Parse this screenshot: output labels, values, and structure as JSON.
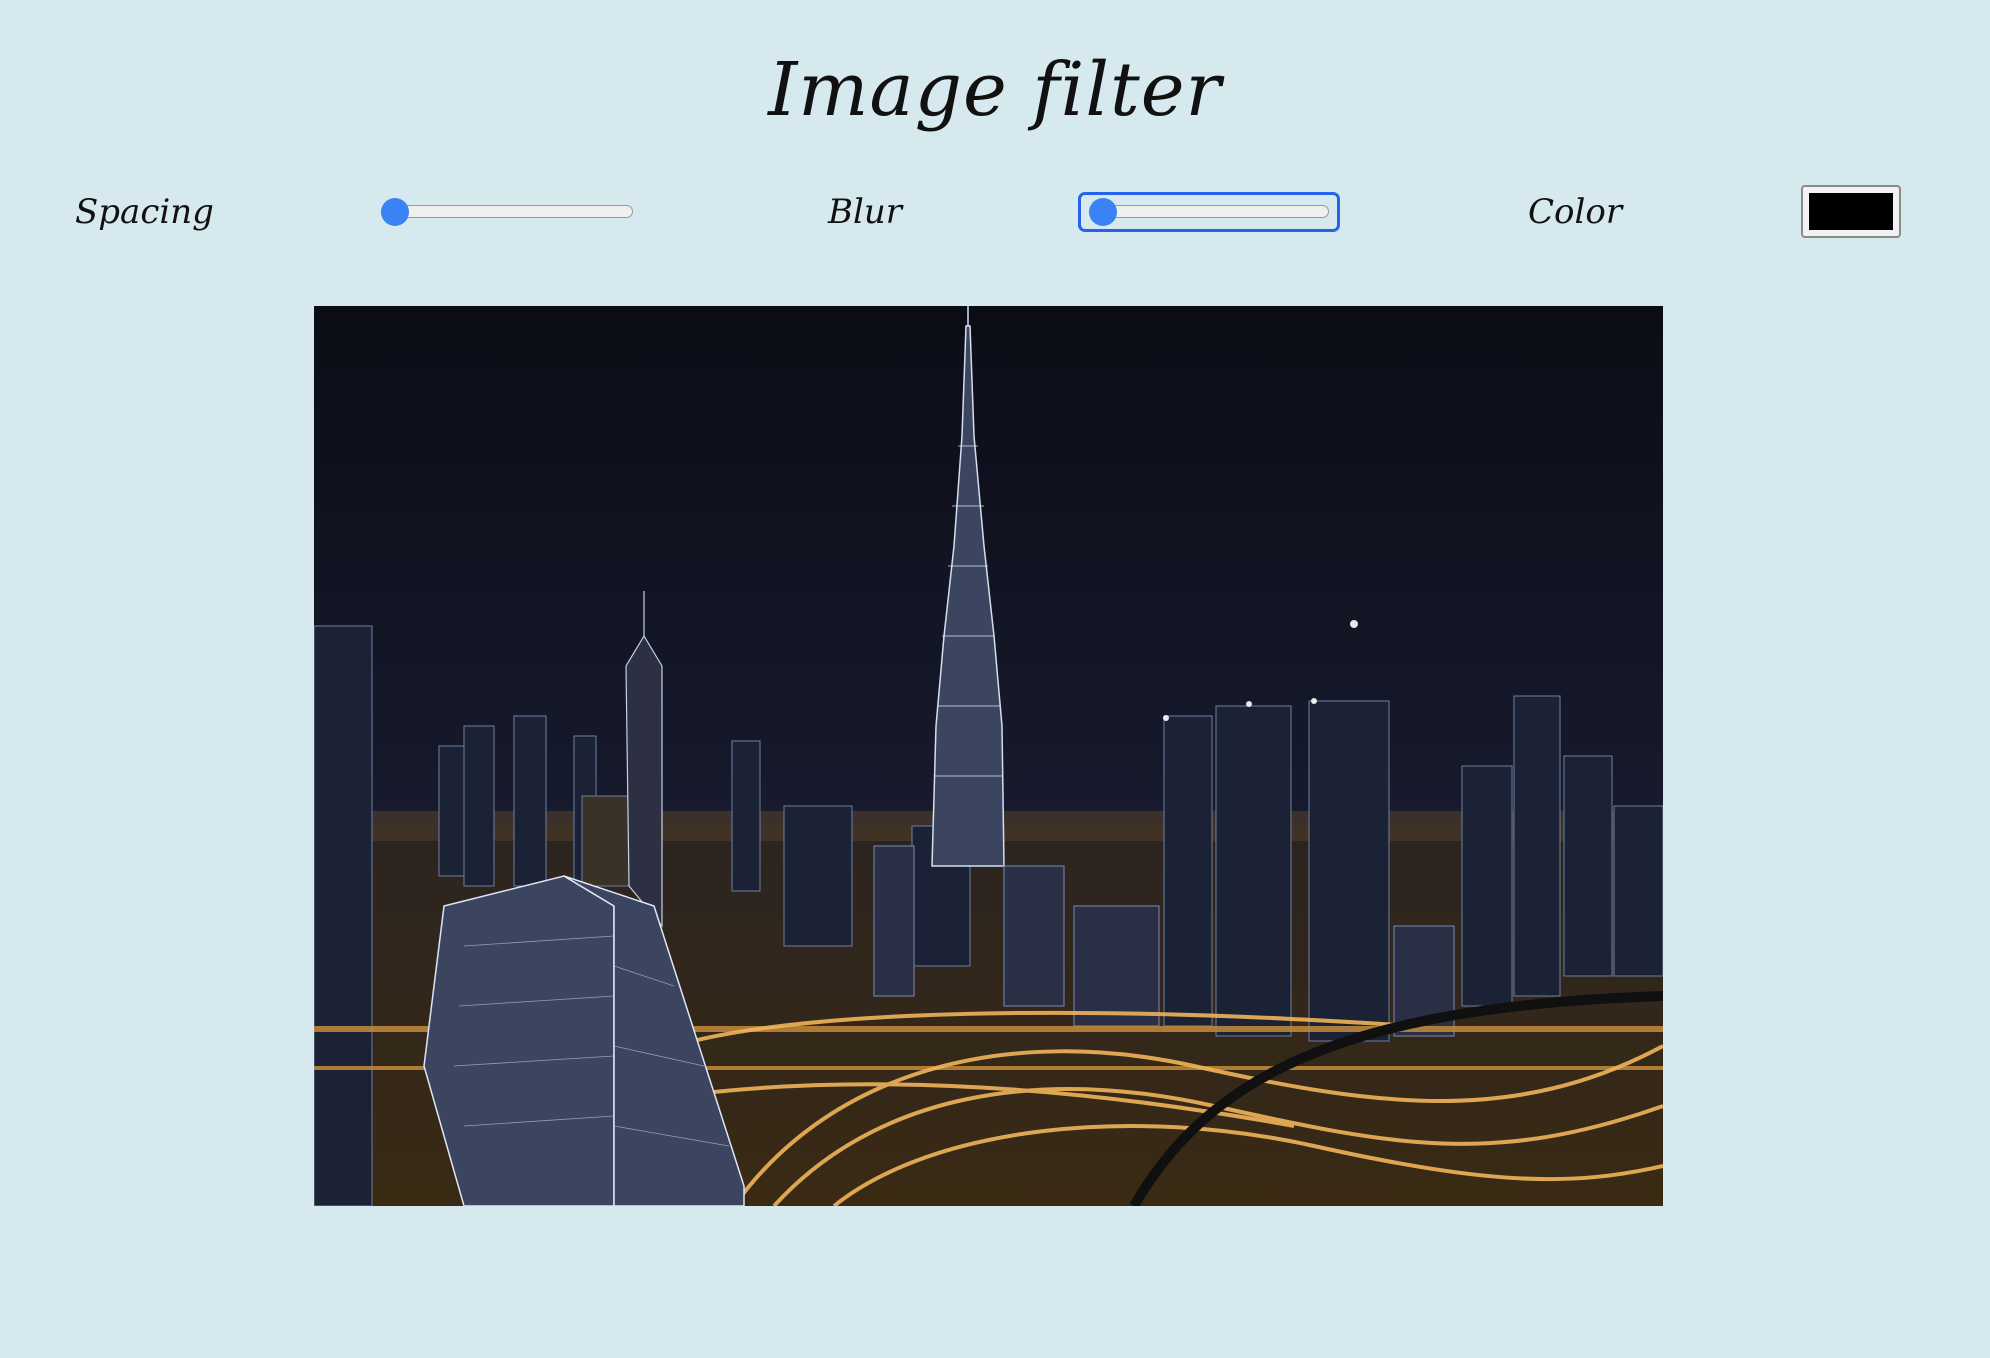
{
  "page": {
    "title": "Image filter"
  },
  "controls": {
    "spacing": {
      "label": "Spacing",
      "value": 0,
      "min": 0,
      "max": 100
    },
    "blur": {
      "label": "Blur",
      "value": 0,
      "min": 0,
      "max": 100,
      "focused": true
    },
    "color": {
      "label": "Color",
      "value": "#000000"
    }
  },
  "image": {
    "description_icon": "city-night-skyline-image"
  },
  "colors": {
    "background": "#d6e9ee",
    "accent": "#3b82f6",
    "focus_ring": "#2563eb"
  }
}
